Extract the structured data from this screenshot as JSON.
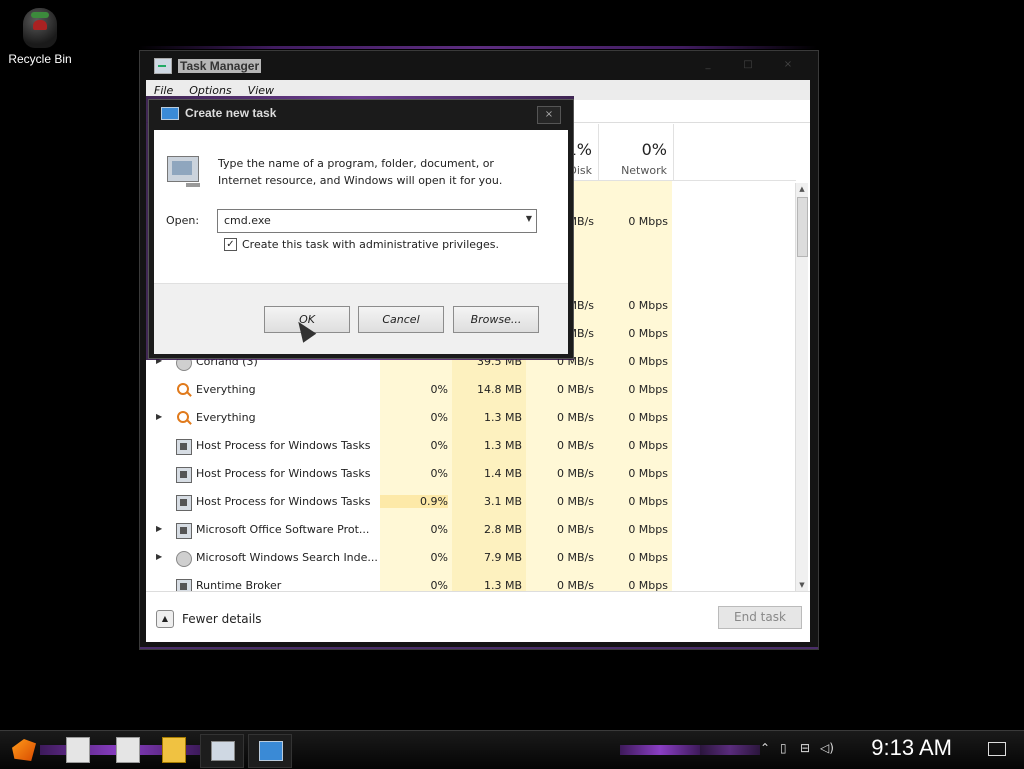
{
  "desktop": {
    "icons": [
      {
        "label": "Recycle Bin"
      }
    ]
  },
  "task_manager": {
    "title": "Task Manager",
    "menu": [
      "File",
      "Options",
      "View"
    ],
    "columns": [
      {
        "pct": "1%",
        "name": "Disk"
      },
      {
        "pct": "0%",
        "name": "Network"
      }
    ],
    "rows": [
      {
        "name": "",
        "cpu": "",
        "mem": "",
        "disk": "",
        "net": ""
      },
      {
        "name": "",
        "cpu": "",
        "mem": "",
        "disk": "MB/s",
        "net": "0 Mbps"
      },
      {
        "name": "",
        "cpu": "",
        "mem": "",
        "disk": "",
        "net": ""
      },
      {
        "name": "",
        "cpu": "",
        "mem": "",
        "disk": "MB/s",
        "net": "0 Mbps"
      },
      {
        "name": "",
        "cpu": "",
        "mem": "",
        "disk": "MB/s",
        "net": "0 Mbps"
      },
      {
        "name": "Corland (3)",
        "cpu": "",
        "mem": "39.5 MB",
        "disk": "0 MB/s",
        "net": "0 Mbps"
      },
      {
        "name": "Everything",
        "cpu": "0%",
        "mem": "14.8 MB",
        "disk": "0 MB/s",
        "net": "0 Mbps"
      },
      {
        "name": "Everything",
        "cpu": "0%",
        "mem": "1.3 MB",
        "disk": "0 MB/s",
        "net": "0 Mbps"
      },
      {
        "name": "Host Process for Windows Tasks",
        "cpu": "0%",
        "mem": "1.3 MB",
        "disk": "0 MB/s",
        "net": "0 Mbps"
      },
      {
        "name": "Host Process for Windows Tasks",
        "cpu": "0%",
        "mem": "1.4 MB",
        "disk": "0 MB/s",
        "net": "0 Mbps"
      },
      {
        "name": "Host Process for Windows Tasks",
        "cpu": "0.9%",
        "mem": "3.1 MB",
        "disk": "0 MB/s",
        "net": "0 Mbps"
      },
      {
        "name": "Microsoft Office Software Prot...",
        "cpu": "0%",
        "mem": "2.8 MB",
        "disk": "0 MB/s",
        "net": "0 Mbps"
      },
      {
        "name": "Microsoft Windows Search Inde...",
        "cpu": "0%",
        "mem": "7.9 MB",
        "disk": "0 MB/s",
        "net": "0 Mbps"
      },
      {
        "name": "Runtime Broker",
        "cpu": "0%",
        "mem": "1.3 MB",
        "disk": "0 MB/s",
        "net": "0 Mbps"
      }
    ],
    "fewer_details": "Fewer details",
    "end_task": "End task"
  },
  "dialog": {
    "title": "Create new task",
    "close": "×",
    "description": "Type the name of a program, folder, document, or Internet resource, and Windows will open it for you.",
    "open_label": "Open:",
    "open_value": "cmd.exe",
    "admin_checkbox_label": "Create this task with administrative privileges.",
    "admin_checked": true,
    "ok": "OK",
    "cancel": "Cancel",
    "browse": "Browse..."
  },
  "taskbar": {
    "clock": "9:13 AM"
  }
}
